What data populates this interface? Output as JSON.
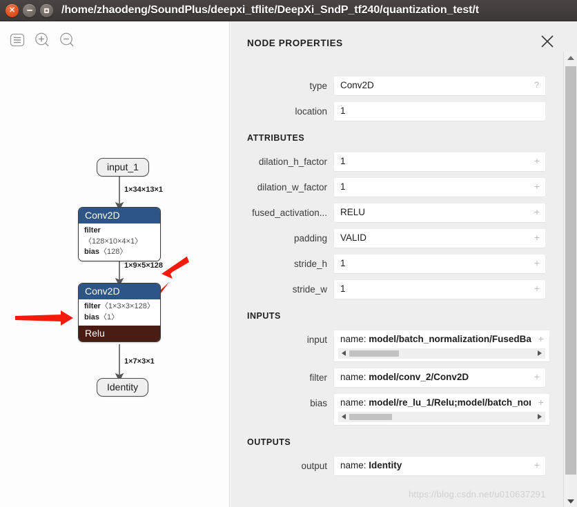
{
  "window": {
    "title": "/home/zhaodeng/SoundPlus/deepxi_tflite/DeepXi_SndP_tf240/quantization_test/t",
    "controls": {
      "close": "close-button",
      "minimize": "minimize-button",
      "maximize": "maximize-button"
    }
  },
  "toolbar": {
    "menu_label": "menu-icon",
    "zoom_in_label": "zoom-in-icon",
    "zoom_out_label": "zoom-out-icon"
  },
  "graph": {
    "nodes": [
      {
        "id": "input_1",
        "kind": "io",
        "label": "input_1"
      },
      {
        "id": "conv2d_1",
        "kind": "op",
        "title": "Conv2D",
        "attrs": [
          {
            "key": "filter",
            "value": "〈128×10×4×1〉"
          },
          {
            "key": "bias",
            "value": "〈128〉"
          }
        ],
        "activation": null
      },
      {
        "id": "conv2d_2",
        "kind": "op",
        "title": "Conv2D",
        "attrs": [
          {
            "key": "filter",
            "value": "〈1×3×3×128〉"
          },
          {
            "key": "bias",
            "value": "〈1〉"
          }
        ],
        "activation": "Relu"
      },
      {
        "id": "identity",
        "kind": "io",
        "label": "Identity"
      }
    ],
    "edge_labels": [
      "1×34×13×1",
      "1×9×5×128",
      "1×7×3×1"
    ],
    "annotations": [
      {
        "name": "arrow-to-output-shape",
        "direction": "down-left"
      },
      {
        "name": "arrow-to-filter",
        "direction": "down-left"
      },
      {
        "name": "arrow-to-bias",
        "direction": "right"
      }
    ],
    "colors": {
      "op_header": "#2e5588",
      "activation": "#4a1d14",
      "annotation": "#ff0000"
    }
  },
  "panel": {
    "title": "NODE PROPERTIES",
    "close_label": "×",
    "basic": [
      {
        "label": "type",
        "value": "Conv2D",
        "hint": "?"
      },
      {
        "label": "location",
        "value": "1",
        "hint": ""
      }
    ],
    "attributes_title": "ATTRIBUTES",
    "attributes": [
      {
        "label": "dilation_h_factor",
        "value": "1"
      },
      {
        "label": "dilation_w_factor",
        "value": "1"
      },
      {
        "label": "fused_activation...",
        "value": "RELU"
      },
      {
        "label": "padding",
        "value": "VALID"
      },
      {
        "label": "stride_h",
        "value": "1"
      },
      {
        "label": "stride_w",
        "value": "1"
      }
    ],
    "inputs_title": "INPUTS",
    "inputs": [
      {
        "label": "input",
        "prefix": "name:",
        "value": "model/batch_normalization/FusedBa",
        "scroll": true
      },
      {
        "label": "filter",
        "prefix": "name:",
        "value": "model/conv_2/Conv2D",
        "scroll": false
      },
      {
        "label": "bias",
        "prefix": "name:",
        "value": "model/re_lu_1/Relu;model/batch_noı",
        "scroll": true
      }
    ],
    "outputs_title": "OUTPUTS",
    "outputs": [
      {
        "label": "output",
        "prefix": "name:",
        "value": "Identity",
        "scroll": false
      }
    ]
  },
  "watermark": "https://blog.csdn.net/u010637291"
}
